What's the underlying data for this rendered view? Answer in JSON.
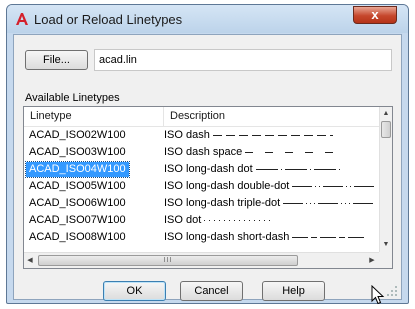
{
  "window": {
    "title": "Load or Reload Linetypes",
    "app_icon": "autocad-a-icon",
    "close_label": "x"
  },
  "file": {
    "button_label": "File...",
    "value": "acad.lin"
  },
  "available_label": "Available Linetypes",
  "list": {
    "columns": [
      "Linetype",
      "Description"
    ],
    "selected_index": 2,
    "rows": [
      {
        "linetype": "ACAD_ISO02W100",
        "description": "ISO dash",
        "pattern": "dash"
      },
      {
        "linetype": "ACAD_ISO03W100",
        "description": "ISO dash space",
        "pattern": "dash-space"
      },
      {
        "linetype": "ACAD_ISO04W100",
        "description": "ISO long-dash dot",
        "pattern": "long-dash-dot"
      },
      {
        "linetype": "ACAD_ISO05W100",
        "description": "ISO long-dash double-dot",
        "pattern": "long-dash-double-dot"
      },
      {
        "linetype": "ACAD_ISO06W100",
        "description": "ISO long-dash triple-dot",
        "pattern": "long-dash-triple-dot"
      },
      {
        "linetype": "ACAD_ISO07W100",
        "description": "ISO dot",
        "pattern": "dot"
      },
      {
        "linetype": "ACAD_ISO08W100",
        "description": "ISO long-dash short-dash",
        "pattern": "long-dash-short-dash"
      }
    ],
    "hscroll_thumb_label": "III"
  },
  "buttons": {
    "ok": "OK",
    "cancel": "Cancel",
    "help": "Help"
  },
  "colors": {
    "selection": "#3399ff",
    "title_bar": "#c6d9ee",
    "close": "#c6472c"
  }
}
